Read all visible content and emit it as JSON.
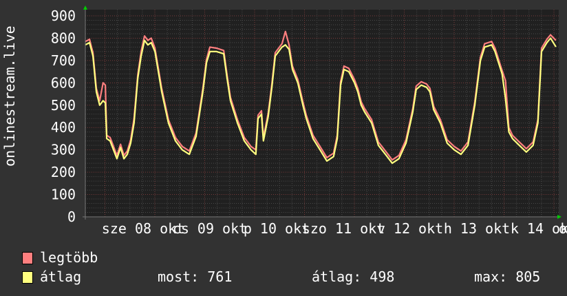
{
  "chart_data": {
    "type": "line",
    "title": "",
    "ylabel": "onlinestream.live",
    "xlabel": "",
    "ylim": [
      0,
      900
    ],
    "yticks": [
      0,
      100,
      200,
      300,
      400,
      500,
      600,
      700,
      800,
      900
    ],
    "xlim_hours": [
      0,
      168
    ],
    "xtick_labels": [
      "sze 08 okt",
      "cs 09 okt",
      "p 10 okt",
      "szo 11 okt",
      "v 12 okt",
      "h 13 okt",
      "k 14 okt",
      "o"
    ],
    "grid": true,
    "x_hours": [
      0,
      1.5,
      2.7,
      3.9,
      5.1,
      6.3,
      7.1,
      7.6,
      8.8,
      10,
      11.2,
      12.5,
      13.7,
      14.9,
      16.1,
      17.3,
      18.6,
      19.8,
      21,
      22.2,
      23.4,
      24.7,
      27.1,
      29.5,
      32,
      34.4,
      36.9,
      39.3,
      41.7,
      43,
      44.2,
      46.6,
      49.1,
      50.3,
      51.5,
      54,
      56.4,
      58.8,
      60.5,
      61.3,
      62.5,
      63.2,
      64.9,
      66.2,
      67.4,
      69.8,
      71,
      72.3,
      73.5,
      75.4,
      77.2,
      78.4,
      80.8,
      83.3,
      85.7,
      88.1,
      89.4,
      90.6,
      91.8,
      93.5,
      95.5,
      96.7,
      97.9,
      99.1,
      101.6,
      104,
      106.5,
      108.9,
      111.3,
      113.8,
      116.2,
      117.4,
      119.2,
      121.1,
      122.3,
      123.6,
      126,
      128.4,
      130.9,
      133.3,
      135.8,
      138.2,
      140.2,
      141.7,
      144.2,
      145.4,
      147.9,
      149.1,
      150.3,
      151.6,
      154,
      156.5,
      158.9,
      160.6,
      161.9,
      163.8,
      165.1,
      167
    ],
    "series": [
      {
        "name": "legtöbb",
        "color": "#ff7f7f",
        "values": [
          785,
          795,
          735,
          575,
          520,
          600,
          590,
          365,
          355,
          315,
          275,
          325,
          275,
          295,
          345,
          440,
          635,
          740,
          810,
          790,
          800,
          755,
          575,
          435,
          355,
          315,
          295,
          375,
          575,
          705,
          760,
          755,
          745,
          635,
          535,
          435,
          355,
          315,
          300,
          455,
          475,
          355,
          465,
          595,
          735,
          775,
          830,
          770,
          675,
          615,
          515,
          455,
          365,
          315,
          265,
          285,
          365,
          605,
          675,
          665,
          615,
          575,
          515,
          485,
          435,
          335,
          295,
          255,
          275,
          345,
          485,
          585,
          605,
          595,
          575,
          495,
          435,
          345,
          315,
          295,
          335,
          515,
          715,
          775,
          785,
          755,
          655,
          610,
          400,
          365,
          335,
          305,
          335,
          435,
          755,
          795,
          815,
          790
        ]
      },
      {
        "name": "átlag",
        "color": "#ffff7f",
        "values": [
          770,
          780,
          720,
          560,
          500,
          520,
          510,
          350,
          340,
          300,
          260,
          310,
          260,
          280,
          330,
          420,
          620,
          720,
          790,
          770,
          780,
          740,
          560,
          420,
          340,
          300,
          280,
          360,
          560,
          690,
          740,
          740,
          730,
          620,
          520,
          420,
          340,
          300,
          280,
          440,
          460,
          340,
          450,
          580,
          720,
          760,
          770,
          750,
          660,
          600,
          500,
          440,
          350,
          300,
          250,
          270,
          350,
          590,
          660,
          650,
          600,
          560,
          500,
          470,
          420,
          320,
          280,
          240,
          260,
          330,
          470,
          570,
          590,
          580,
          560,
          480,
          420,
          330,
          300,
          280,
          320,
          500,
          700,
          760,
          770,
          740,
          640,
          530,
          380,
          350,
          320,
          290,
          320,
          420,
          740,
          780,
          800,
          761
        ]
      }
    ]
  },
  "legend": {
    "max_label": "legtöbb",
    "avg_label": "átlag",
    "now": "most: 761",
    "avg": "átlag: 498",
    "max": "max: 805"
  }
}
